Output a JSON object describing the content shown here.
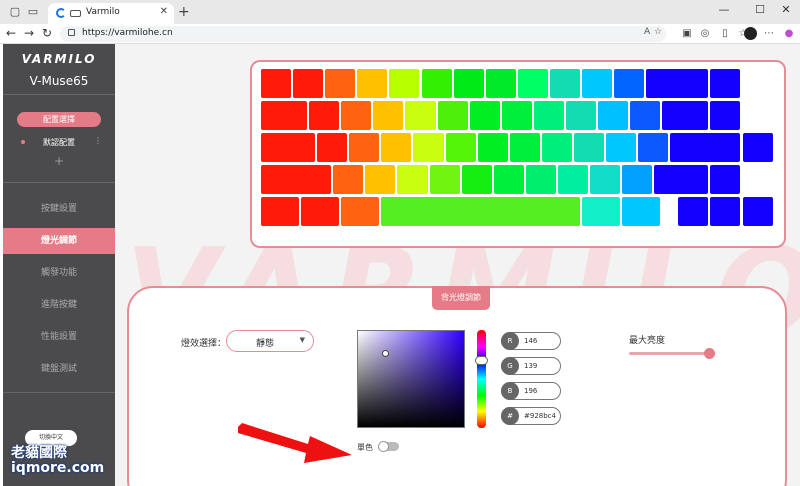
{
  "browser": {
    "tab_title": "Varmilo",
    "tab_close": "✕",
    "new_tab": "+",
    "url": "https://varmilohe.cn",
    "read_aloud": "A",
    "window": {
      "minimize": "—",
      "maximize": "☐",
      "close": "✕"
    }
  },
  "sidebar": {
    "logo": "VARMILO",
    "model": "V-Muse65",
    "config_button": "配置選擇",
    "config_item": "默認配置",
    "config_more": "⋮",
    "add": "+",
    "nav": [
      "按鍵設置",
      "燈光調節",
      "觸發功能",
      "進階按鍵",
      "性能設置",
      "鍵盤測試"
    ],
    "active_index": 1,
    "lang_button": "切換中文",
    "watermark_line1": "老貓國際",
    "watermark_line2": "iqmore.com"
  },
  "background_watermark": "VARMILO",
  "keyboard": {
    "accent": "#e88b95",
    "rows": [
      [
        "#ff1a0a",
        "#ff1a0a",
        "#ff6310",
        "#ffc000",
        "#b8ff00",
        "#33f000",
        "#00ea18",
        "#00ea28",
        "#00ff64",
        "#12ddb0",
        "#00c8ff",
        "#0066ff",
        "#1400ff",
        "#1400ff"
      ],
      [
        "#ff1a0a",
        "#ff1a0a",
        "#ff6310",
        "#ffc000",
        "#c8ff10",
        "#4cf00a",
        "#00ee22",
        "#00ee3c",
        "#00ee7a",
        "#12ddb0",
        "#00c0ff",
        "#0a5aff",
        "#1400ff",
        "#1400ff"
      ],
      [
        "#ff1a0a",
        "#ff1a0a",
        "#ff6310",
        "#ffc000",
        "#c8ff10",
        "#55f50a",
        "#00ee22",
        "#00ee3c",
        "#00ee7a",
        "#12ddb0",
        "#00c8ff",
        "#0a5aff",
        "#1400ff",
        "#1400ff"
      ],
      [
        "#ff1a0a",
        "#ff6310",
        "#ffc000",
        "#c8ff10",
        "#70f510",
        "#15ee10",
        "#00ee3c",
        "#00ee6e",
        "#00eea0",
        "#12ddc8",
        "#00a0ff",
        "#1400ff",
        "#1400ff"
      ],
      [
        "#ff1a0a",
        "#ff1a0a",
        "#ff6310",
        "#55ee22",
        "#12eec8",
        "#00c8ff",
        "#1400ff",
        "#1400ff",
        "#1400ff"
      ]
    ]
  },
  "lighting": {
    "tab": "背光燈調節",
    "effect_label": "燈效選擇：",
    "effect_value": "靜態",
    "picker": {
      "saturation": 0.26,
      "brightness": 0.77,
      "hue_position": 0.31
    },
    "rgb": [
      {
        "label": "R",
        "value": "146"
      },
      {
        "label": "G",
        "value": "139"
      },
      {
        "label": "B",
        "value": "196"
      },
      {
        "label": "#",
        "value": "#928bc4"
      }
    ],
    "mono_label": "單色",
    "mono_on": false,
    "brightness_label": "最大亮度",
    "brightness_level": 1.0
  }
}
